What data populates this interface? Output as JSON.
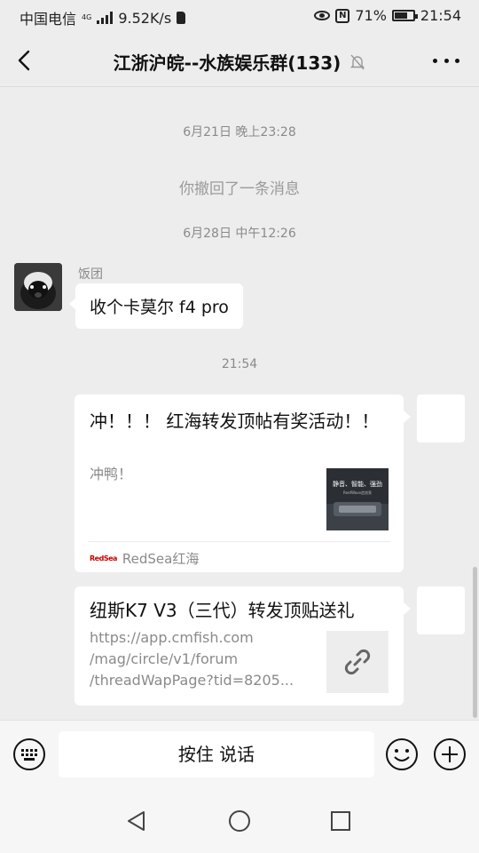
{
  "status_bar": {
    "carrier": "中国电信",
    "network": "4G",
    "speed": "9.52K/s",
    "battery": "71%",
    "battery_level": 0.71,
    "time": "21:54"
  },
  "header": {
    "title": "江浙沪皖--水族娱乐群(133)",
    "back_icon": "chevron-left-icon",
    "mute_icon": "bell-muted-icon",
    "more_icon": "more-dots-icon"
  },
  "chat": {
    "time_1": "6月21日 晚上23:28",
    "system_msg": "你撤回了一条消息",
    "time_2": "6月28日 中午12:26",
    "incoming": {
      "sender": "饭团",
      "text": "收个卡莫尔 f4 pro"
    },
    "time_3": "21:54",
    "card1": {
      "title": "冲！！！ 红海转发顶帖有奖活动！！",
      "desc": "冲鸭！",
      "thumb_text": "静音、智能、强劲",
      "thumb_subtext": "ReefWave造浪泵",
      "source": "RedSea红海",
      "source_logo": "RedSea"
    },
    "card2": {
      "title": "纽斯K7 V3（三代）转发顶贴送礼",
      "url_line1": "https://app.cmfish.com",
      "url_line2": "/mag/circle/v1/forum",
      "url_line3": "/threadWapPage?tid=8205...",
      "thumb_icon": "link-icon"
    }
  },
  "input_bar": {
    "talk_label": "按住 说话",
    "keyboard_icon": "keyboard-icon",
    "emoji_icon": "emoji-icon",
    "plus_icon": "plus-circle-icon"
  },
  "nav_bar": {
    "back": "triangle-back-icon",
    "home": "circle-home-icon",
    "recents": "square-recents-icon"
  }
}
